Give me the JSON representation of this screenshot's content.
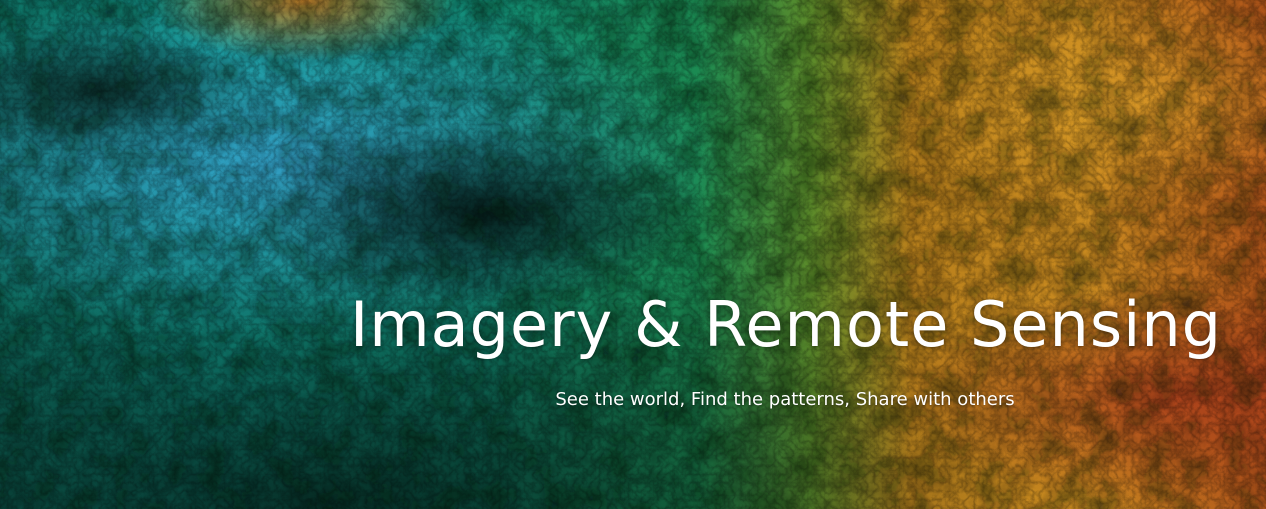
{
  "hero": {
    "title": "Imagery & Remote Sensing",
    "subtitle": "See the world, Find the patterns, Share with others",
    "background_image": "satellite-terrain-image",
    "colors": {
      "left_tone": "#0f8a7a",
      "mid_tone": "#1f6f3a",
      "right_tone": "#c8821a",
      "text": "#ffffff"
    }
  }
}
